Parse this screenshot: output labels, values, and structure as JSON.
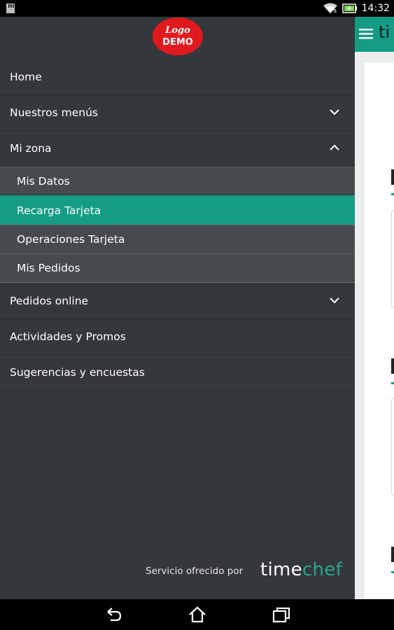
{
  "status_bar": {
    "time": "14:32",
    "icons": [
      "sd-card-icon",
      "wifi-icon",
      "battery-charging-icon"
    ]
  },
  "drawer": {
    "logo": {
      "line1": "Logo",
      "line2": "DEMO",
      "color": "#e0191e"
    },
    "items": [
      {
        "label": "Home"
      },
      {
        "label": "Nuestros menús",
        "expand_icon": "chevron-down-icon"
      },
      {
        "label": "Mi zona",
        "expand_icon": "chevron-up-icon"
      }
    ],
    "sub_items": [
      {
        "label": "Mis Datos",
        "active": false
      },
      {
        "label": "Recarga Tarjeta",
        "active": true
      },
      {
        "label": "Operaciones Tarjeta",
        "active": false
      },
      {
        "label": "Mis Pedidos",
        "active": false
      }
    ],
    "items_after": [
      {
        "label": "Pedidos online",
        "expand_icon": "chevron-down-icon"
      },
      {
        "label": "Actividades y Promos"
      },
      {
        "label": "Sugerencias y encuestas"
      }
    ],
    "footer": {
      "service_text": "Servicio ofrecido por",
      "brand_part1": "time",
      "brand_part2": "chef"
    }
  },
  "app": {
    "toolbar_title": "ti",
    "accent_color": "#149c84"
  },
  "colors": {
    "drawer_bg": "#34373b",
    "sub_item_bg": "#464a4e",
    "active_bg": "#149c84"
  },
  "nav_bar": {
    "buttons": [
      "back-icon",
      "home-icon",
      "recents-icon"
    ]
  }
}
